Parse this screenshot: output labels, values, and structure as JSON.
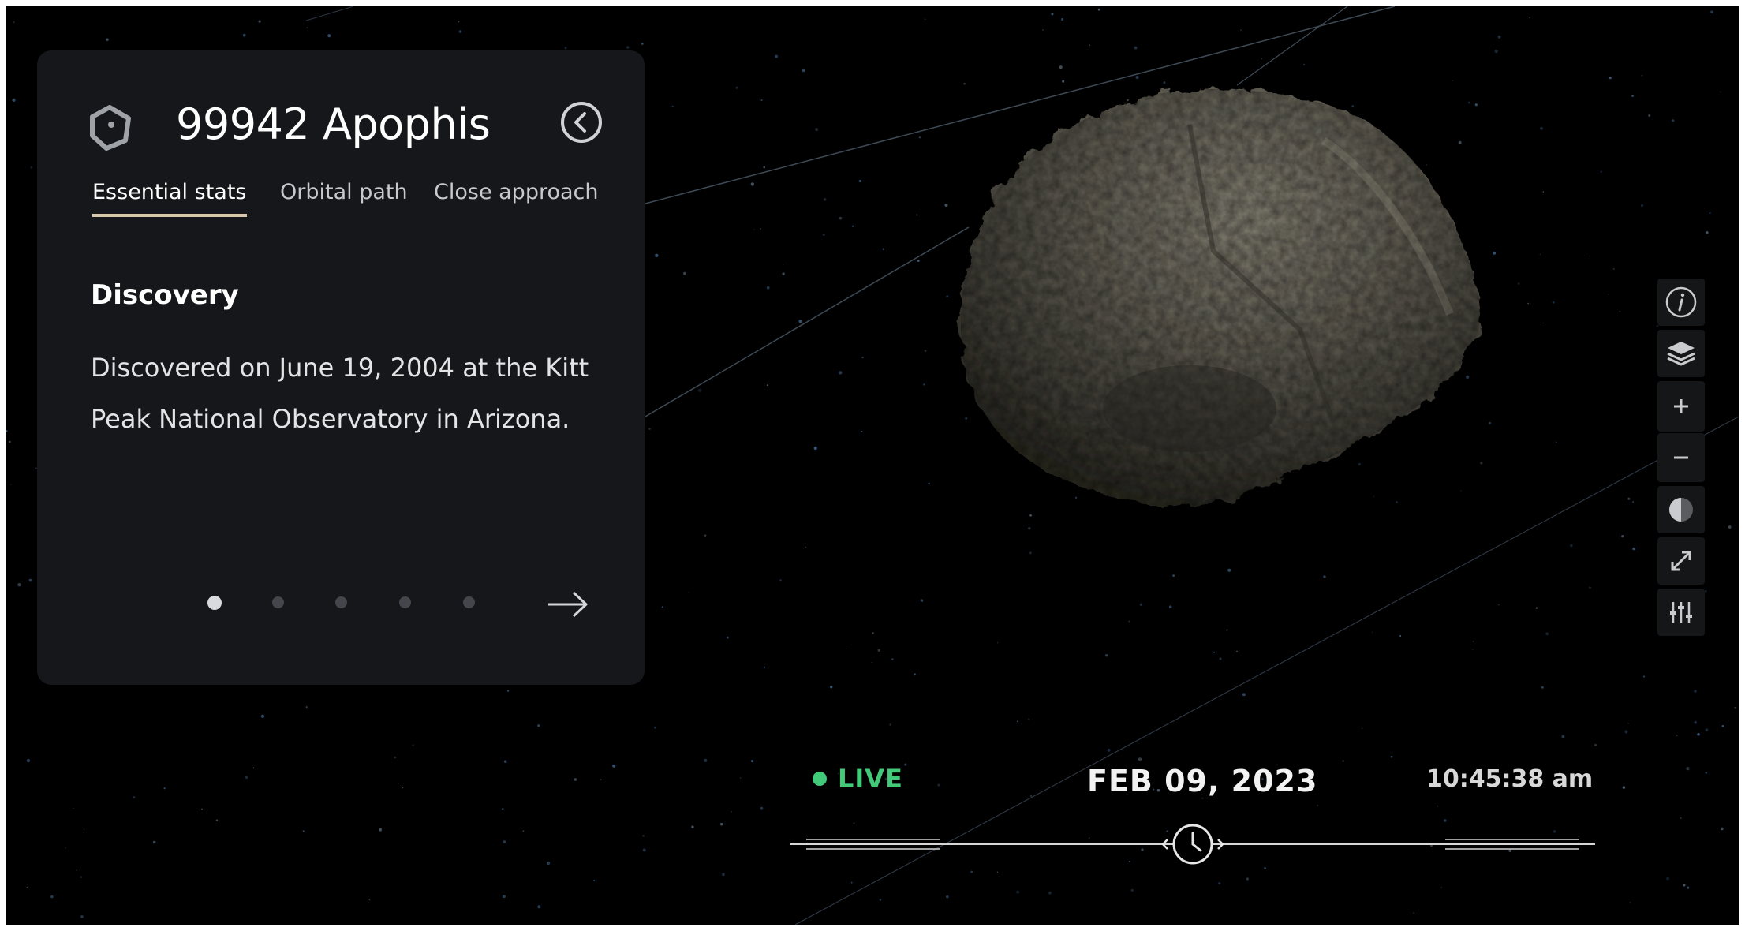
{
  "panel": {
    "object_icon": "asteroid-hexagon-icon",
    "title": "99942 Apophis",
    "back_icon": "chevron-left-circle-icon",
    "tabs": [
      {
        "label": "Essential stats",
        "active": true
      },
      {
        "label": "Orbital path",
        "active": false
      },
      {
        "label": "Close approach",
        "active": false
      }
    ],
    "section_heading": "Discovery",
    "section_text": "Discovered on June 19, 2004 at the Kitt Peak National Observatory in Arizona.",
    "pager": {
      "total": 5,
      "current": 1
    },
    "next_icon": "arrow-right-icon"
  },
  "toolbar": {
    "buttons": [
      {
        "name": "info-button",
        "icon": "info-icon"
      },
      {
        "name": "layers-button",
        "icon": "layers-icon"
      },
      {
        "name": "zoom-in-button",
        "icon": "plus-icon"
      },
      {
        "name": "zoom-out-button",
        "icon": "minus-icon"
      },
      {
        "name": "lighting-button",
        "icon": "half-circle-icon"
      },
      {
        "name": "fullscreen-button",
        "icon": "expand-icon"
      },
      {
        "name": "settings-button",
        "icon": "sliders-icon"
      }
    ]
  },
  "time": {
    "live_label": "LIVE",
    "date": "FEB 09, 2023",
    "clock": "10:45:38 am",
    "slider_icon": "clock-icon"
  },
  "colors": {
    "live_green": "#43c97a",
    "tab_underline": "#d8c7a8",
    "panel_bg": "#16171a"
  }
}
